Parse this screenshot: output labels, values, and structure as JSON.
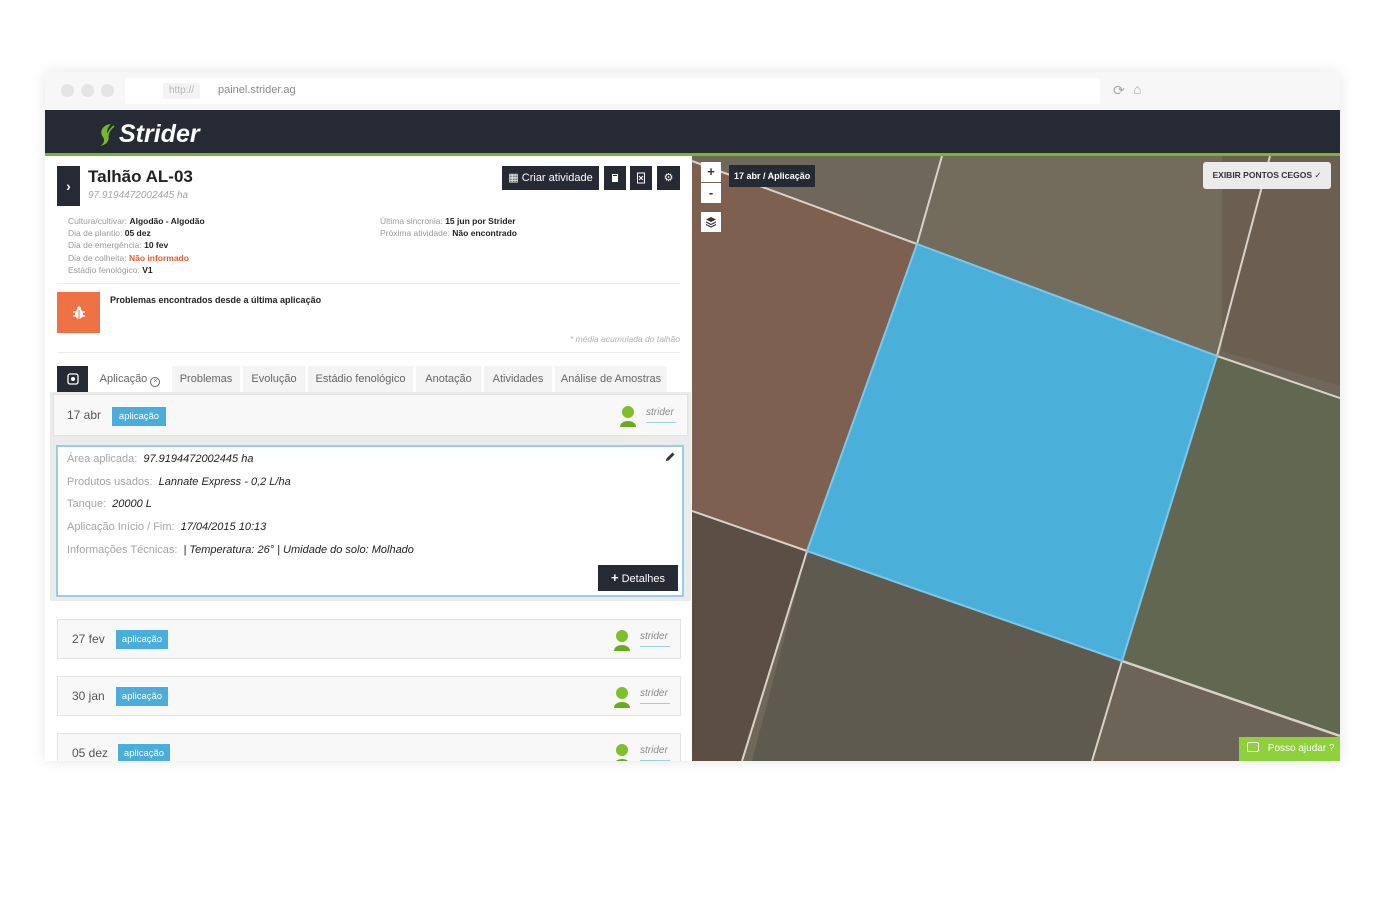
{
  "browser": {
    "protocol": "http://",
    "url": "painel.strider.ag"
  },
  "app": {
    "brand": "Strider",
    "brand_color": "#76b82a"
  },
  "field": {
    "title": "Talhão AL-03",
    "area": "97.9194472002445 ha",
    "info_left": [
      {
        "label": "Cultura/cultivar:",
        "value": "Algodão - Algodão"
      },
      {
        "label": "Dia de plantio:",
        "value": "05 dez"
      },
      {
        "label": "Dia de emergência:",
        "value": "10 fev"
      },
      {
        "label": "Dia de colheita:",
        "value": "Não informado"
      },
      {
        "label": "Estádio fenológico:",
        "value": "V1"
      }
    ],
    "info_right": [
      {
        "label": "Última sincronia:",
        "value": "15 jun por Strider"
      },
      {
        "label": "Próxima atividade:",
        "value": "Não encontrado"
      }
    ],
    "problems_text": "Problemas encontrados desde a última aplicação",
    "average_note": "* média acumulada do talhão"
  },
  "toolbar": {
    "create_activity": "Criar atividade"
  },
  "tabs": [
    "Aplicação",
    "Problemas",
    "Evolução",
    "Estádio fenológico",
    "Anotação",
    "Atividades",
    "Análise de Amostras"
  ],
  "applications": [
    {
      "date": "17 abr",
      "badge": "aplicação",
      "user": "strider"
    },
    {
      "date": "27 fev",
      "badge": "aplicação",
      "user": "strider"
    },
    {
      "date": "30 jan",
      "badge": "aplicação",
      "user": "strider"
    },
    {
      "date": "05 dez",
      "badge": "aplicação",
      "user": "strider"
    }
  ],
  "detail": {
    "rows": [
      {
        "label": "Área aplicada:",
        "value": "97.9194472002445 ha"
      },
      {
        "label": "Produtos usados:",
        "value": "Lannate Express - 0,2 L/ha"
      },
      {
        "label": "Tanque:",
        "value": "20000 L"
      },
      {
        "label": "Aplicação Início / Fim:",
        "value": "17/04/2015 10:13"
      },
      {
        "label": "Informações Técnicas:",
        "value": "| Temperatura: 26° | Umidade do solo: Molhado"
      }
    ],
    "button": "Detalhes"
  },
  "map": {
    "zoom_in": "+",
    "zoom_out": "-",
    "label": "17 abr / Aplicação",
    "blind_spots": "EXIBIR PONTOS CEGOS",
    "help": "Posso ajudar ?",
    "field_color": "#4aafd9"
  }
}
